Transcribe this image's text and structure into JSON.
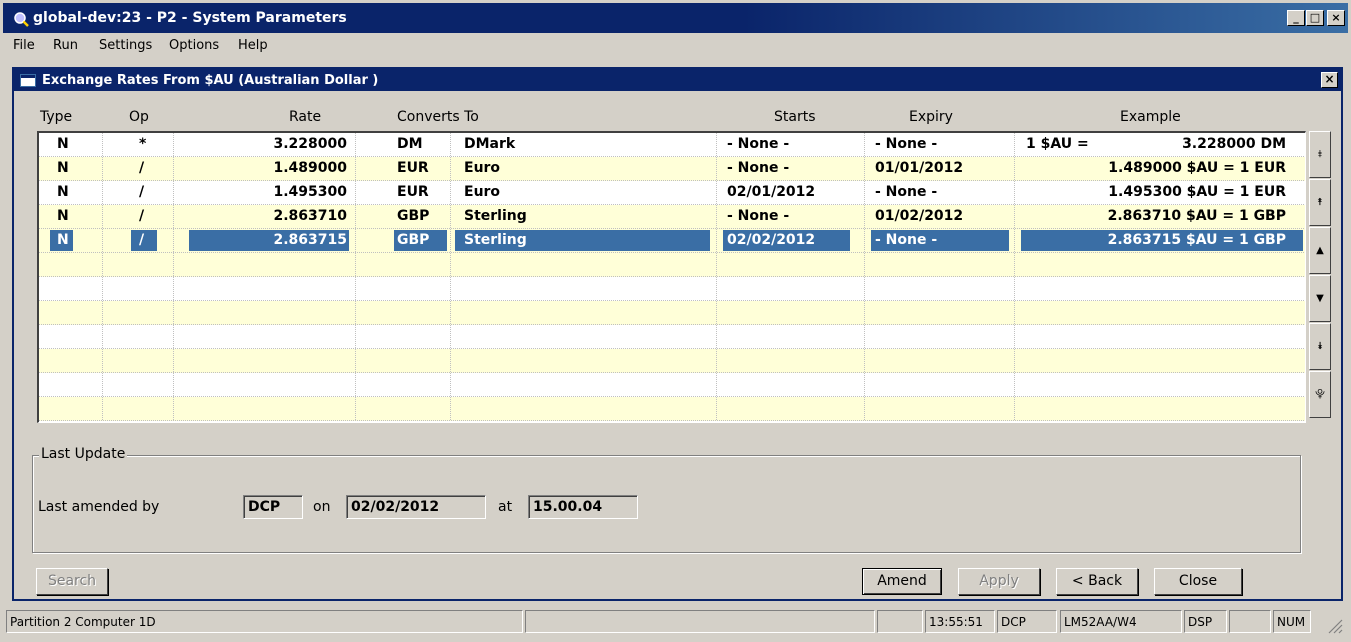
{
  "window": {
    "title": "global-dev:23 - P2 - System Parameters",
    "controls": [
      "_",
      "□",
      "×"
    ]
  },
  "menu": [
    {
      "label": "File"
    },
    {
      "label": "Run"
    },
    {
      "label": "Settings"
    },
    {
      "label": "Options"
    },
    {
      "label": "Help"
    }
  ],
  "dialog": {
    "title": "Exchange Rates From $AU (Australian Dollar )",
    "close": "×"
  },
  "grid": {
    "columns": [
      "Type",
      "Op",
      "Rate",
      "Converts To",
      "Starts",
      "Expiry",
      "Example"
    ],
    "rows": [
      {
        "type": "N",
        "op": "*",
        "rate": "3.228000",
        "code": "DM",
        "name": "DMark",
        "starts": "- None -",
        "expiry": "- None -",
        "example_a": "1 $AU =",
        "example_b": "3.228000 DM"
      },
      {
        "type": "N",
        "op": "/",
        "rate": "1.489000",
        "code": "EUR",
        "name": "Euro",
        "starts": "- None -",
        "expiry": "01/01/2012",
        "example_a": "",
        "example_b": "1.489000 $AU = 1 EUR"
      },
      {
        "type": "N",
        "op": "/",
        "rate": "1.495300",
        "code": "EUR",
        "name": "Euro",
        "starts": "02/01/2012",
        "expiry": "- None -",
        "example_a": "",
        "example_b": "1.495300 $AU = 1 EUR"
      },
      {
        "type": "N",
        "op": "/",
        "rate": "2.863710",
        "code": "GBP",
        "name": "Sterling",
        "starts": "- None -",
        "expiry": "01/02/2012",
        "example_a": "",
        "example_b": "2.863710 $AU = 1 GBP"
      },
      {
        "type": "N",
        "op": "/",
        "rate": "2.863715",
        "code": "GBP",
        "name": "Sterling",
        "starts": "02/02/2012",
        "expiry": "- None -",
        "example_a": "",
        "example_b": "2.863715 $AU = 1 GBP"
      }
    ],
    "selected_row": 4,
    "colors": {
      "row_alt": "#ffffd8",
      "selection": "#3a6ea5"
    }
  },
  "scroll_buttons": [
    {
      "name": "scroll-top-icon",
      "glyph": "⯒"
    },
    {
      "name": "scroll-page-up-icon",
      "glyph": "⯭"
    },
    {
      "name": "scroll-up-icon",
      "glyph": "▲"
    },
    {
      "name": "scroll-down-icon",
      "glyph": "▼"
    },
    {
      "name": "scroll-page-down-icon",
      "glyph": "⯯"
    },
    {
      "name": "scroll-bottom-icon",
      "glyph": "⯓"
    }
  ],
  "last_update": {
    "legend": "Last Update",
    "amended_label": "Last amended by",
    "amended_by": "DCP",
    "on_label": "on",
    "date": "02/02/2012",
    "at_label": "at",
    "time": "15.00.04"
  },
  "buttons": {
    "search": "Search",
    "amend": "Amend",
    "apply": "Apply",
    "back": "< Back",
    "close": "Close"
  },
  "status": {
    "partition": "Partition 2 Computer 1D",
    "time": "13:55:51",
    "user": "DCP",
    "terminal": "LM52AA/W4",
    "mode": "DSP",
    "num": "NUM"
  }
}
